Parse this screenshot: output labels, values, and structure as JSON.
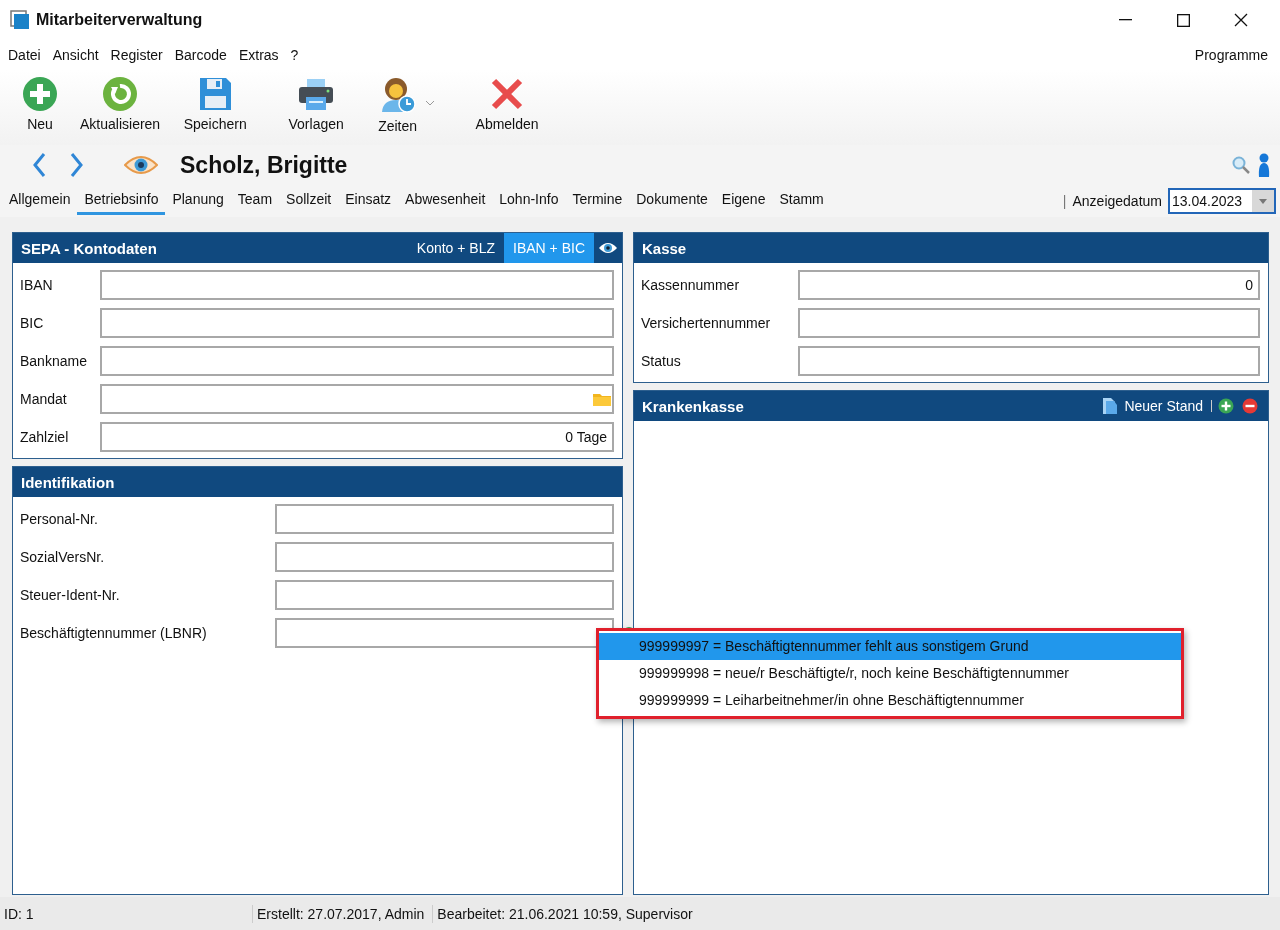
{
  "window": {
    "title": "Mitarbeiterverwaltung"
  },
  "menu": [
    "Datei",
    "Ansicht",
    "Register",
    "Barcode",
    "Extras",
    "?"
  ],
  "menu_right": "Programme",
  "toolbar": [
    {
      "label": "Neu",
      "kind": "new"
    },
    {
      "label": "Aktualisieren",
      "kind": "refresh"
    },
    {
      "label": "Speichern",
      "kind": "save"
    },
    {
      "label": "Vorlagen",
      "kind": "print"
    },
    {
      "label": "Zeiten",
      "kind": "times"
    },
    {
      "label": "Abmelden",
      "kind": "logout"
    }
  ],
  "record": {
    "name": "Scholz, Brigitte"
  },
  "tabs": [
    {
      "label": "Allgemein",
      "selected": false
    },
    {
      "label": "Betriebsinfo",
      "selected": true
    },
    {
      "label": "Planung",
      "selected": false
    },
    {
      "label": "Team",
      "selected": false
    },
    {
      "label": "Sollzeit",
      "selected": false
    },
    {
      "label": "Einsatz",
      "selected": false
    },
    {
      "label": "Abwesenheit",
      "selected": false
    },
    {
      "label": "Lohn-Info",
      "selected": false
    },
    {
      "label": "Termine",
      "selected": false
    },
    {
      "label": "Dokumente",
      "selected": false
    },
    {
      "label": "Eigene",
      "selected": false
    },
    {
      "label": "Stamm",
      "selected": false
    }
  ],
  "display_date": {
    "separator": "|",
    "label": "Anzeigedatum",
    "value": "13.04.2023"
  },
  "sepa": {
    "title": "SEPA - Kontodaten",
    "modes": [
      {
        "label": "Konto + BLZ",
        "selected": false
      },
      {
        "label": "IBAN + BIC",
        "selected": true
      }
    ],
    "fields": [
      {
        "label": "IBAN",
        "kind": "text"
      },
      {
        "label": "BIC",
        "kind": "text"
      },
      {
        "label": "Bankname",
        "kind": "text"
      },
      {
        "label": "Mandat",
        "kind": "file"
      },
      {
        "label": "Zahlziel",
        "kind": "text",
        "value": "0 Tage"
      }
    ]
  },
  "identifikation": {
    "title": "Identifikation",
    "fields": [
      {
        "label": "Personal-Nr.",
        "kind": "text"
      },
      {
        "label": "SozialVersNr.",
        "kind": "text"
      },
      {
        "label": "Steuer-Ident-Nr.",
        "kind": "text"
      },
      {
        "label": "Beschäftigtennummer (LBNR)",
        "kind": "lookup"
      }
    ]
  },
  "kasse": {
    "title": "Kasse",
    "fields": [
      {
        "label": "Kassennummer",
        "kind": "text",
        "value": "0"
      },
      {
        "label": "Versichertennummer",
        "kind": "text"
      },
      {
        "label": "Status",
        "kind": "text"
      }
    ]
  },
  "krankenkasse": {
    "title": "Krankenkasse",
    "action": "Neuer Stand"
  },
  "popup": [
    {
      "text": "999999997 = Beschäftigtennummer fehlt aus sonstigem Grund",
      "selected": true
    },
    {
      "text": "999999998 = neue/r Beschäftigte/r, noch keine Beschäftigtennummer",
      "selected": false
    },
    {
      "text": "999999999 = Leiharbeitnehmer/in ohne Beschäftigtennummer",
      "selected": false
    }
  ],
  "status_bar": [
    "ID: 1",
    "Erstellt: 27.07.2017, Admin",
    "Bearbeitet: 21.06.2021 10:59, Supervisor"
  ]
}
